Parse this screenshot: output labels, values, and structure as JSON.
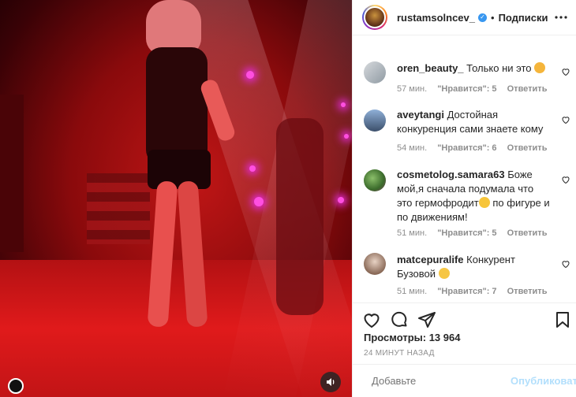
{
  "header": {
    "username": "rustamsolncev_",
    "dot": "•",
    "follow_label": "Подписки"
  },
  "comments": [
    {
      "username": "oren_beauty_",
      "text": "Только ни это",
      "emoji": "person-gesturing-no-emoji",
      "time": "57 мин.",
      "likes": "\"Нравится\": 5",
      "reply": "Ответить"
    },
    {
      "username": "aveytangi",
      "text": "Достойная конкуренция сами знаете кому",
      "time": "54 мин.",
      "likes": "\"Нравится\": 6",
      "reply": "Ответить"
    },
    {
      "username": "cosmetolog.samara63",
      "text_before": "Боже мой,я сначала подумала что это гермофродит",
      "emoji": "blush-emoji",
      "text_after": "по фигуре и по движениям!",
      "time": "51 мин.",
      "likes": "\"Нравится\": 5",
      "reply": "Ответить"
    },
    {
      "username": "matcepuralife",
      "text": "Конкурент Бузовой",
      "emoji": "clapping-hands-emoji",
      "time": "51 мин.",
      "likes": "\"Нравится\": 7",
      "reply": "Ответить"
    }
  ],
  "actions": {
    "icons": [
      "heart-icon",
      "comment-icon",
      "share-icon",
      "bookmark-icon"
    ]
  },
  "views": "Просмотры: 13 964",
  "posted_ago": "24 МИНУТ НАЗАД",
  "add_comment": {
    "placeholder": "Добавьте",
    "publish_label": "Опубликовать"
  },
  "colors": {
    "link_blue": "#3897f0",
    "publish_disabled": "#b2dffc",
    "secondary_text": "#8e8e8e"
  }
}
